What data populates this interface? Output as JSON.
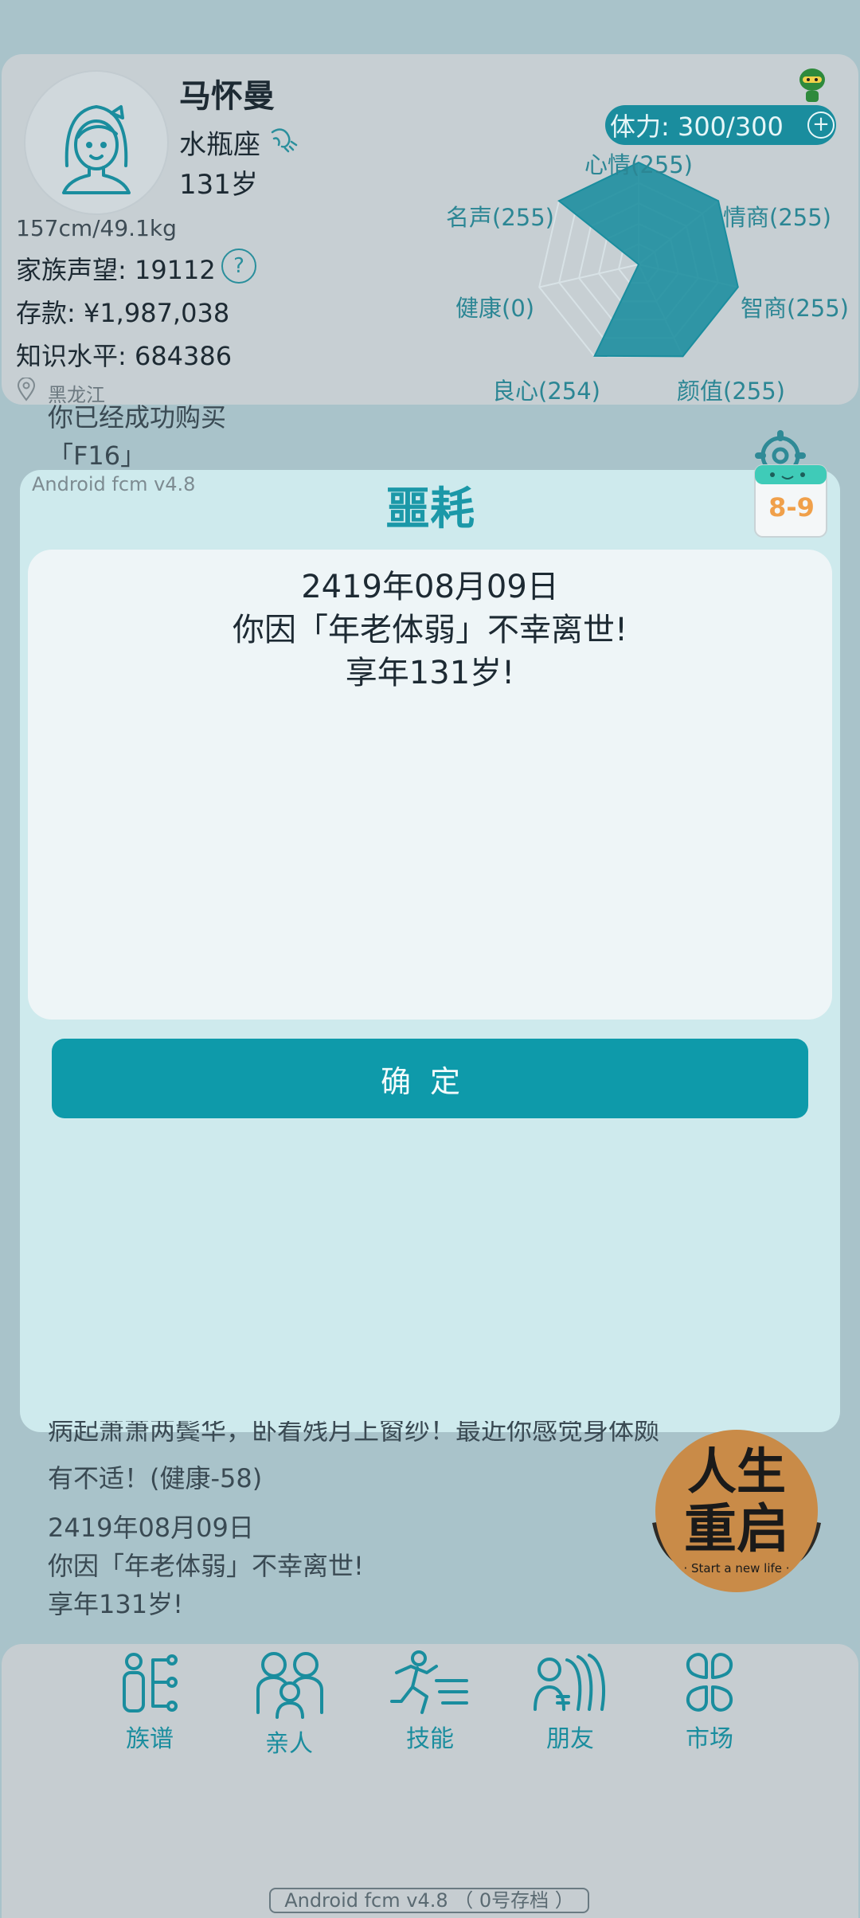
{
  "profile": {
    "name": "马怀曼",
    "zodiac": "水瓶座",
    "age": "131岁",
    "body": "157cm/49.1kg",
    "reputation": "家族声望: 19112",
    "help": "?",
    "savings": "存款: ¥1,987,038",
    "knowledge": "知识水平: 684386",
    "location": "黑龙江"
  },
  "stamina": {
    "label": "体力: 300/300",
    "add": "+"
  },
  "radar": {
    "labels": {
      "mood": "心情(255)",
      "eq": "情商(255)",
      "iq": "智商(255)",
      "looks": "颜值(255)",
      "conscience": "良心(254)",
      "health": "健康(0)",
      "fame": "名声(255)"
    },
    "values": [
      255,
      255,
      255,
      255,
      254,
      0,
      255
    ],
    "max": 255
  },
  "log_top": {
    "line1": "你已经成功购买",
    "line2": "「F16」"
  },
  "modal": {
    "version": "Android fcm v4.8",
    "title": "噩耗",
    "date": "2419年08月09日",
    "message": "你因「年老体弱」不幸离世!",
    "age_line": "享年131岁!",
    "confirm": "确定"
  },
  "calendar_badge": "8-9",
  "log_bottom": {
    "line1": "病起萧萧两鬓华，卧看残月上窗纱！最近你感觉身体颇",
    "line2": "有不适！(健康-58)",
    "date": "2419年08月09日",
    "message": "你因「年老体弱」不幸离世!",
    "age_line": "享年131岁!"
  },
  "restart": {
    "title_line1": "人生",
    "title_line2": "重启",
    "subtitle": "· Start a new life ·"
  },
  "nav": {
    "items": [
      {
        "label": "族谱",
        "icon": "family-tree-icon"
      },
      {
        "label": "亲人",
        "icon": "relatives-icon"
      },
      {
        "label": "技能",
        "icon": "skills-icon"
      },
      {
        "label": "朋友",
        "icon": "friends-icon"
      },
      {
        "label": "市场",
        "icon": "market-icon"
      }
    ]
  },
  "footer": {
    "version": "Android fcm v4.8 （ 0号存档 ）"
  },
  "colors": {
    "accent": "#1a8d9e",
    "modal_bg": "#ceeaed",
    "button": "#0e9aaa"
  }
}
